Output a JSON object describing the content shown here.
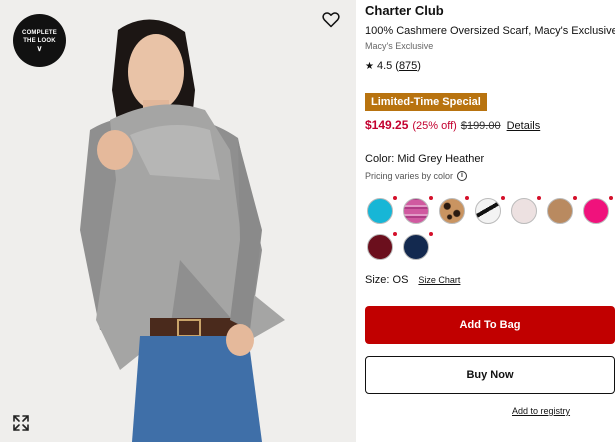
{
  "image": {
    "complete_look_line1": "COMPLETE",
    "complete_look_line2": "THE LOOK",
    "complete_look_icon": "chevron-down-icon",
    "wishlist_icon": "heart-icon",
    "expand_icon": "expand-icon"
  },
  "product": {
    "brand": "Charter Club",
    "title": "100% Cashmere Oversized Scarf, Macy's Exclusive",
    "exclusive_label": "Macy's Exclusive",
    "rating_value": "4.5",
    "review_count": "875",
    "promo_badge": "Limited-Time Special",
    "sale_price": "$149.25",
    "percent_off": "(25% off)",
    "original_price": "$199.00",
    "details_link": "Details",
    "color_label": "Color: Mid Grey Heather",
    "pricing_note": "Pricing varies by color",
    "size_label": "Size: OS",
    "size_chart_link": "Size Chart",
    "add_to_bag": "Add To Bag",
    "buy_now": "Buy Now",
    "add_to_registry": "Add to registry"
  },
  "swatches": [
    {
      "name": "turquoise",
      "color": "#17b6d6",
      "selected": false
    },
    {
      "name": "pink-stripe",
      "color": "#d05aa0",
      "selected": false
    },
    {
      "name": "leopard",
      "color": "#8a5a3a",
      "selected": false
    },
    {
      "name": "black-white",
      "color": "#f2f2f2",
      "selected": false
    },
    {
      "name": "light-pink",
      "color": "#ede1e1",
      "selected": false
    },
    {
      "name": "camel",
      "color": "#b98a60",
      "selected": false
    },
    {
      "name": "hot-pink",
      "color": "#f0127c",
      "selected": false
    },
    {
      "name": "burgundy",
      "color": "#6b0f1d",
      "selected": false
    },
    {
      "name": "navy",
      "color": "#13294f",
      "selected": false
    }
  ],
  "colors": {
    "accent_red": "#c10000",
    "sale_red": "#c3002f",
    "promo_badge": "#b8730f"
  }
}
